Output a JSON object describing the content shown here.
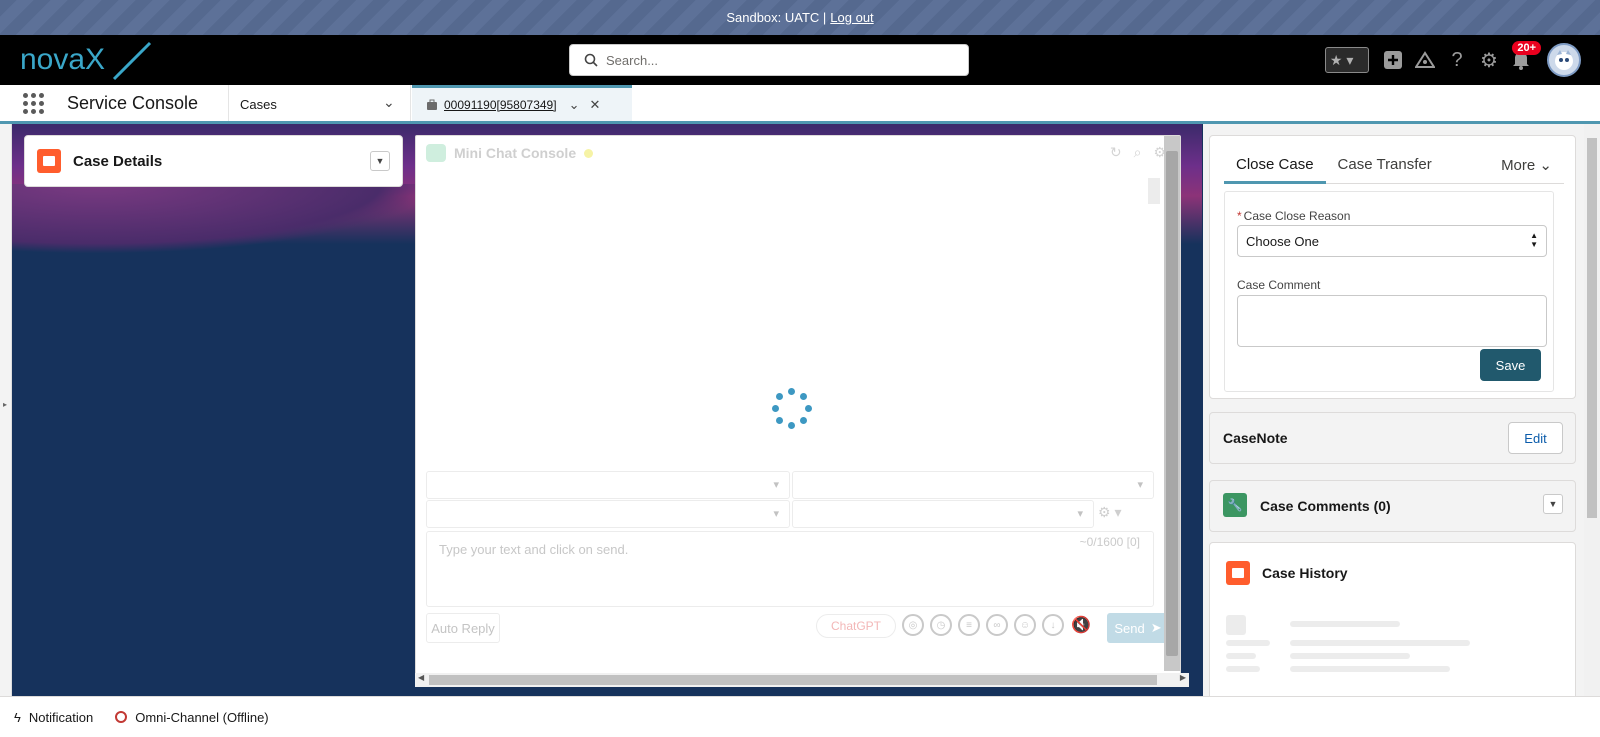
{
  "sandbox": {
    "text": "Sandbox: UATC |",
    "logout": "Log out"
  },
  "header": {
    "logo_text": "novaX",
    "search": {
      "placeholder": "Search..."
    },
    "notification_badge": "20+"
  },
  "nav": {
    "app_name": "Service Console",
    "object": "Cases",
    "tab_label": "00091190[95807349]"
  },
  "case_details": {
    "title": "Case Details"
  },
  "chat": {
    "title": "Mini Chat Console",
    "input_placeholder": "Type your text and click on send.",
    "counter": "~0/1600 [0]",
    "auto_reply": "Auto Reply",
    "chatgpt": "ChatGPT",
    "send": "Send"
  },
  "close_case": {
    "tabs": [
      "Close Case",
      "Case Transfer",
      "More"
    ],
    "reason_label": "Case Close Reason",
    "reason_value": "Choose One",
    "comment_label": "Case Comment",
    "save": "Save"
  },
  "casenote": {
    "title": "CaseNote",
    "edit": "Edit"
  },
  "case_comments": {
    "title": "Case Comments (0)"
  },
  "case_history": {
    "title": "Case History"
  },
  "utility": {
    "notification": "Notification",
    "omni": "Omni-Channel (Offline)"
  },
  "colors": {
    "accent": "#4f97b0",
    "save_button": "#21596d",
    "case_orange": "#ff5d2d"
  }
}
